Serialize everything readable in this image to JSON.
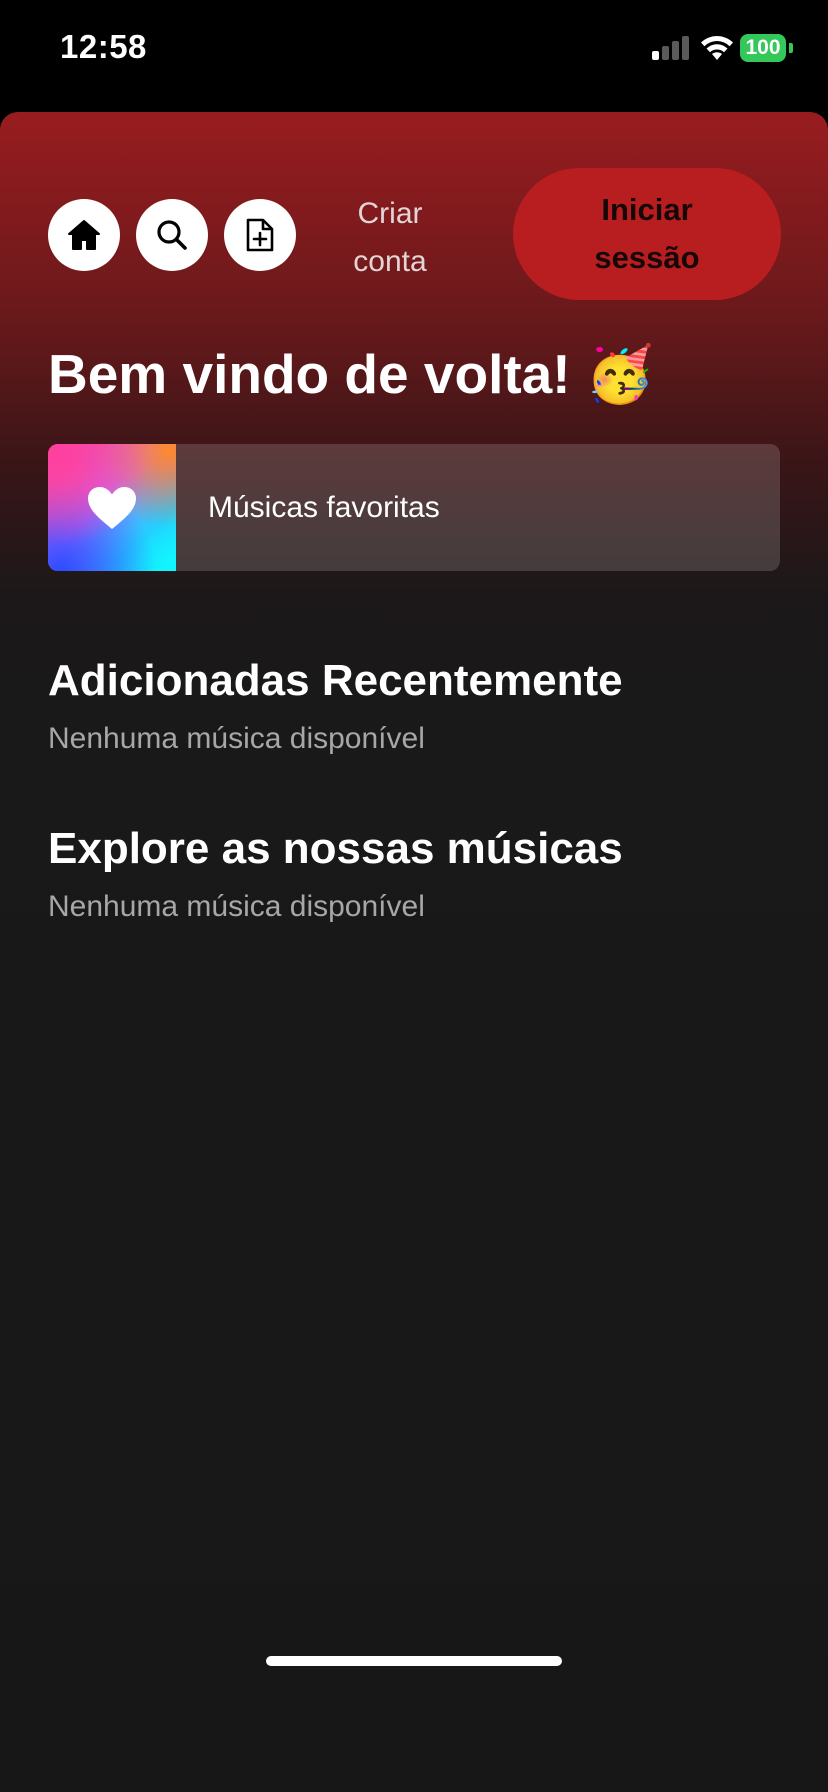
{
  "status_bar": {
    "time": "12:58",
    "battery_level": "100",
    "battery_color": "#34c759",
    "icons": [
      "signal-icon",
      "wifi-icon",
      "battery-icon"
    ]
  },
  "header": {
    "nav_icons": [
      "home-icon",
      "search-icon",
      "add-document-icon"
    ],
    "create_account_label": "Criar conta",
    "login_label": "Iniciar sessão",
    "login_color": "#b81d20"
  },
  "main": {
    "welcome_title": "Bem vindo de volta! 🥳",
    "favorites": {
      "label": "Músicas favoritas",
      "icon": "heart-icon"
    },
    "sections": [
      {
        "title": "Adicionadas Recentemente",
        "empty_message": "Nenhuma música disponível"
      },
      {
        "title": "Explore as nossas músicas",
        "empty_message": "Nenhuma música disponível"
      }
    ]
  },
  "theme": {
    "accent": "#981c1f",
    "background": "#171717"
  }
}
